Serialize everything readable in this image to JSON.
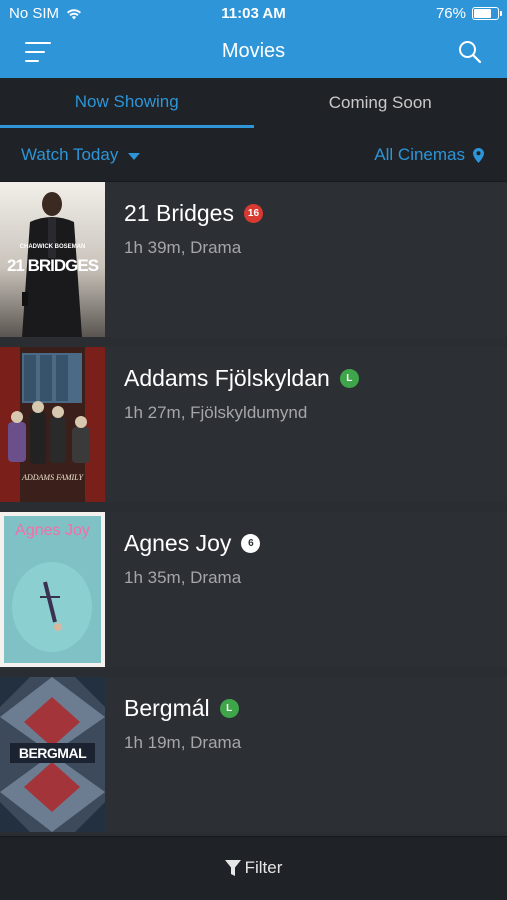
{
  "status_bar": {
    "carrier": "No SIM",
    "time": "11:03 AM",
    "battery_pct": "76%",
    "battery_level": 0.76
  },
  "nav": {
    "title": "Movies",
    "menu_icon": "hamburger-icon",
    "search_icon": "search-icon"
  },
  "tabs": [
    {
      "label": "Now Showing",
      "active": true
    },
    {
      "label": "Coming Soon",
      "active": false
    }
  ],
  "filters": {
    "date_label": "Watch Today",
    "cinema_label": "All Cinemas"
  },
  "movies": [
    {
      "title": "21 Bridges",
      "rating": "16",
      "rating_color": "#d83a32",
      "meta": "1h 39m, Drama",
      "poster_top": "CHADWICK BOSEMAN",
      "poster_main": "21 BRIDGES"
    },
    {
      "title": "Addams Fjölskyldan",
      "rating": "L",
      "rating_color": "#3fa54a",
      "meta": "1h 27m, Fjölskyldumynd",
      "poster_main": "ADDAMS FAMILY"
    },
    {
      "title": "Agnes Joy",
      "rating": "6",
      "rating_color": "#ffffff",
      "meta": "1h 35m, Drama",
      "poster_main": "Agnes Joy"
    },
    {
      "title": "Bergmál",
      "rating": "L",
      "rating_color": "#3fa54a",
      "meta": "1h 19m, Drama",
      "poster_main": "BERGMAL"
    }
  ],
  "bottom": {
    "filter_label": "Filter"
  },
  "colors": {
    "accent": "#2d95d8",
    "background": "#2a2d32",
    "row": "#2c2f34",
    "bar": "#1f2226"
  }
}
